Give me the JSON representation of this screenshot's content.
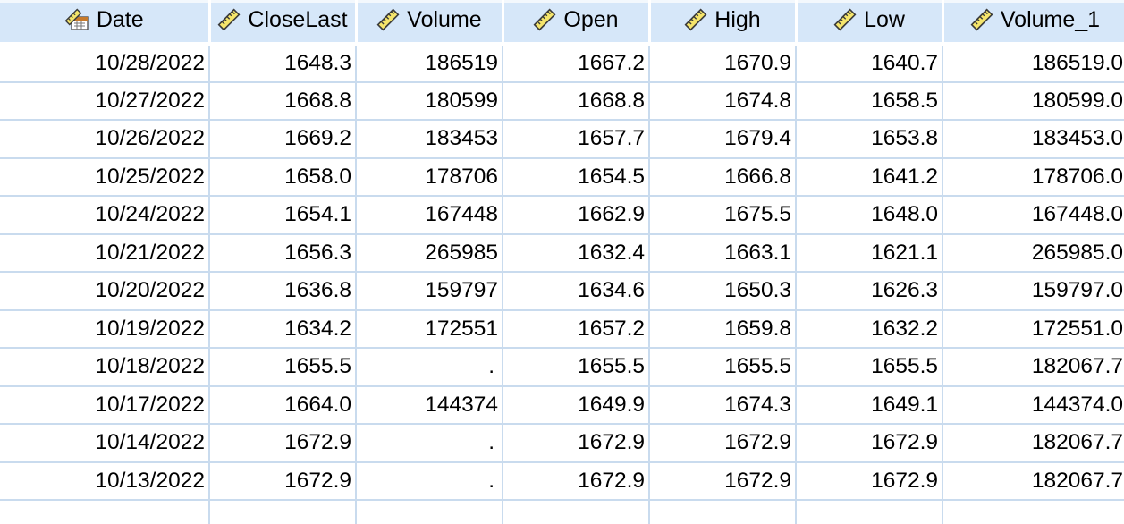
{
  "columns": [
    {
      "label": "Date",
      "type": "date",
      "icon": "date-variable-icon"
    },
    {
      "label": "CloseLast",
      "type": "scale",
      "icon": "scale-ruler-icon"
    },
    {
      "label": "Volume",
      "type": "scale",
      "icon": "scale-ruler-icon"
    },
    {
      "label": "Open",
      "type": "scale",
      "icon": "scale-ruler-icon"
    },
    {
      "label": "High",
      "type": "scale",
      "icon": "scale-ruler-icon"
    },
    {
      "label": "Low",
      "type": "scale",
      "icon": "scale-ruler-icon"
    },
    {
      "label": "Volume_1",
      "type": "scale",
      "icon": "scale-ruler-icon"
    }
  ],
  "rows": [
    [
      "10/28/2022",
      "1648.3",
      "186519",
      "1667.2",
      "1670.9",
      "1640.7",
      "186519.0"
    ],
    [
      "10/27/2022",
      "1668.8",
      "180599",
      "1668.8",
      "1674.8",
      "1658.5",
      "180599.0"
    ],
    [
      "10/26/2022",
      "1669.2",
      "183453",
      "1657.7",
      "1679.4",
      "1653.8",
      "183453.0"
    ],
    [
      "10/25/2022",
      "1658.0",
      "178706",
      "1654.5",
      "1666.8",
      "1641.2",
      "178706.0"
    ],
    [
      "10/24/2022",
      "1654.1",
      "167448",
      "1662.9",
      "1675.5",
      "1648.0",
      "167448.0"
    ],
    [
      "10/21/2022",
      "1656.3",
      "265985",
      "1632.4",
      "1663.1",
      "1621.1",
      "265985.0"
    ],
    [
      "10/20/2022",
      "1636.8",
      "159797",
      "1634.6",
      "1650.3",
      "1626.3",
      "159797.0"
    ],
    [
      "10/19/2022",
      "1634.2",
      "172551",
      "1657.2",
      "1659.8",
      "1632.2",
      "172551.0"
    ],
    [
      "10/18/2022",
      "1655.5",
      ".",
      "1655.5",
      "1655.5",
      "1655.5",
      "182067.7"
    ],
    [
      "10/17/2022",
      "1664.0",
      "144374",
      "1649.9",
      "1674.3",
      "1649.1",
      "144374.0"
    ],
    [
      "10/14/2022",
      "1672.9",
      ".",
      "1672.9",
      "1672.9",
      "1672.9",
      "182067.7"
    ],
    [
      "10/13/2022",
      "1672.9",
      ".",
      "1672.9",
      "1672.9",
      "1672.9",
      "182067.7"
    ],
    [
      "",
      "",
      "",
      "",
      "",
      "",
      ""
    ]
  ],
  "colors": {
    "header_bg": "#d6e7f9",
    "gridline": "#c9dbee",
    "ruler_fill": "#f5e56b",
    "ruler_stroke": "#3b3b3b"
  }
}
